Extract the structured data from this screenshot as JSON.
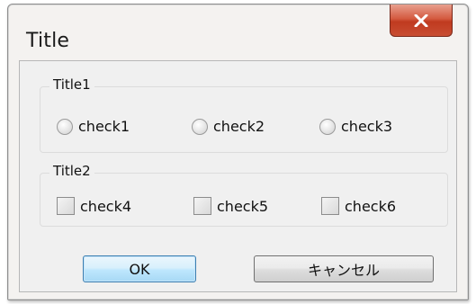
{
  "window": {
    "title": "Title"
  },
  "group1": {
    "legend": "Title1",
    "options": [
      "check1",
      "check2",
      "check3"
    ]
  },
  "group2": {
    "legend": "Title2",
    "options": [
      "check4",
      "check5",
      "check6"
    ]
  },
  "buttons": {
    "ok_label": "OK",
    "cancel_label": "キャンセル"
  },
  "icons": {
    "close": "close-icon",
    "radio": "radio-button",
    "checkbox": "checkbox"
  },
  "colors": {
    "close_button": "#c84e33",
    "ok_border": "#3c7fb1"
  }
}
